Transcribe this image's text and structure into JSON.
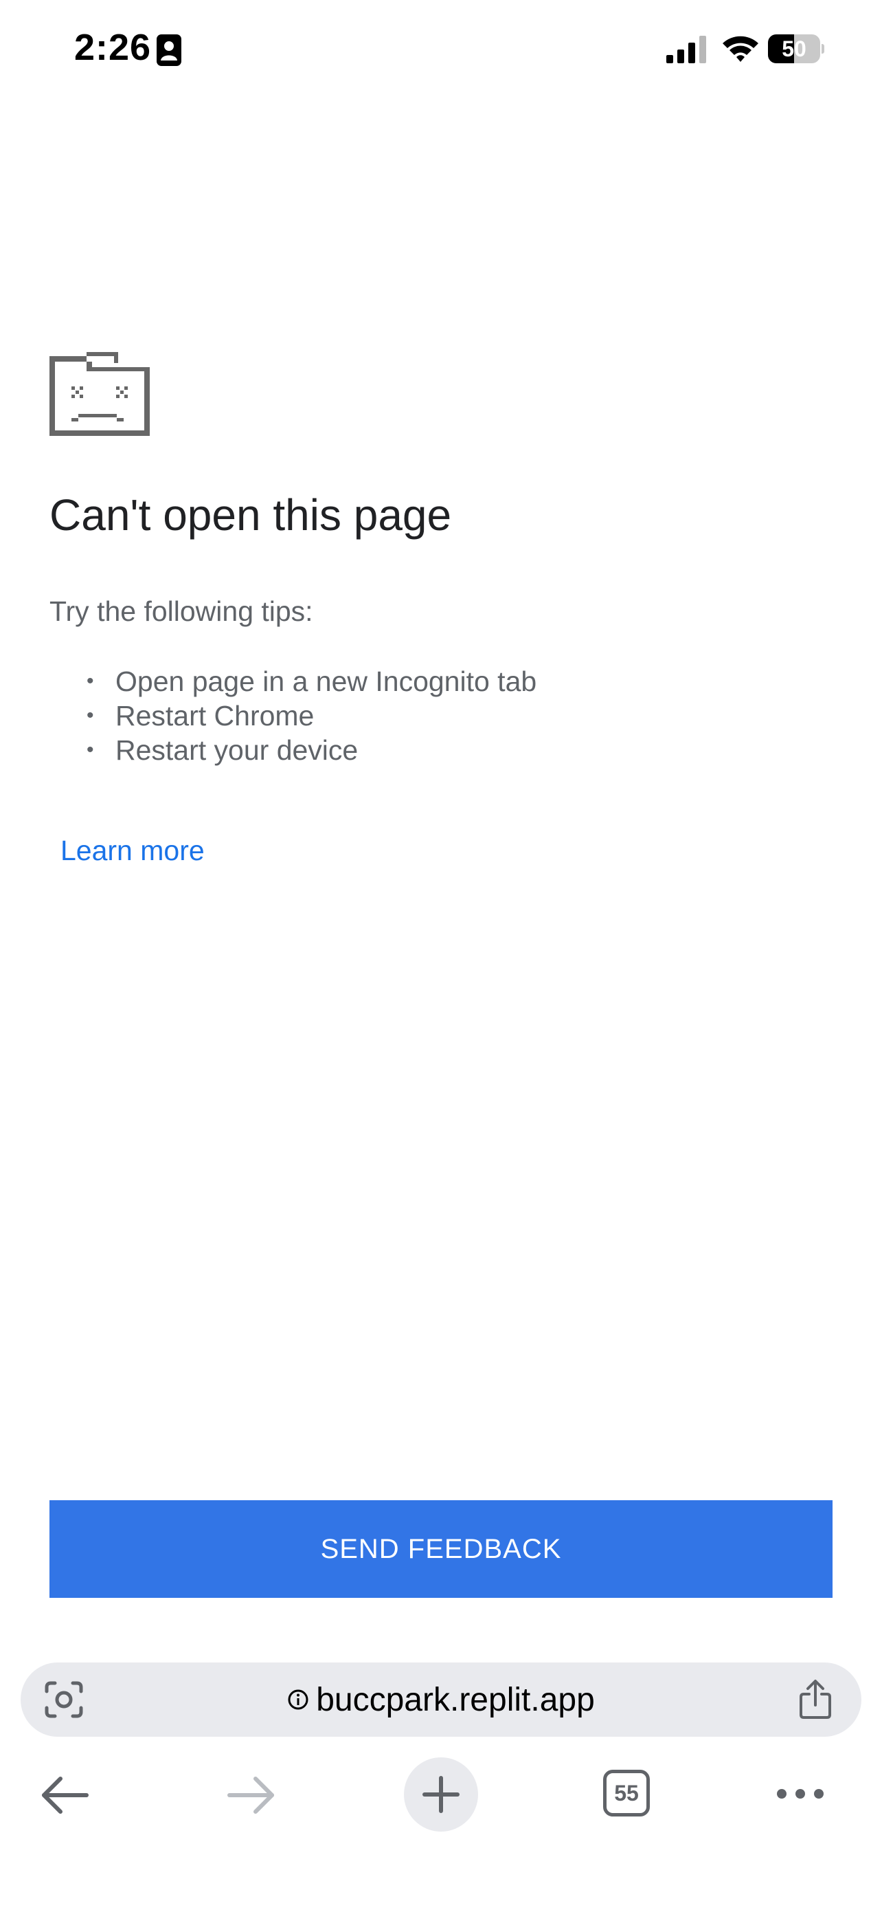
{
  "status_bar": {
    "time": "2:26",
    "battery_level": "50",
    "battery_fraction": 0.5,
    "icons": [
      "contact-card-icon",
      "cellular-signal-icon",
      "wifi-icon",
      "battery-icon"
    ]
  },
  "error_page": {
    "icon": "sad-folder-icon",
    "title": "Can't open this page",
    "tips_intro": "Try the following tips:",
    "tips": [
      "Open page in a new Incognito tab",
      "Restart Chrome",
      "Restart your device"
    ],
    "learn_more": "Learn more",
    "feedback_button": "SEND FEEDBACK"
  },
  "address_bar": {
    "url": "buccpark.replit.app",
    "icons": [
      "lens-icon",
      "info-icon",
      "share-icon"
    ]
  },
  "toolbar": {
    "tab_count": "55",
    "icons": [
      "back-arrow-icon",
      "forward-arrow-icon",
      "plus-icon",
      "tab-switcher-icon",
      "more-options-icon"
    ]
  },
  "colors": {
    "accent_button": "#3275e6",
    "link": "#1a73e8",
    "title_text": "#202124",
    "body_text": "#5f6368",
    "toolbar_icon": "#606368",
    "address_bar_bg": "#e9eaee"
  }
}
